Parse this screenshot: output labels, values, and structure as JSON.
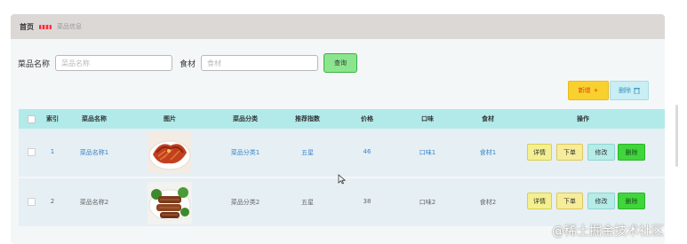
{
  "breadcrumb": {
    "home": "首页",
    "current": "菜品信息"
  },
  "search": {
    "name_label": "菜品名称",
    "name_placeholder": "菜品名称",
    "ingredient_label": "食材",
    "ingredient_placeholder": "食材",
    "query_label": "查询"
  },
  "actions": {
    "add_label": "新增",
    "delete_label": "删除"
  },
  "table": {
    "headers": [
      "索引",
      "菜品名称",
      "图片",
      "菜品分类",
      "推荐指数",
      "价格",
      "口味",
      "食材",
      "操作"
    ],
    "rows": [
      {
        "index": "1",
        "name": "菜品名称1",
        "category": "菜品分类1",
        "rating": "五星",
        "price": "46",
        "taste": "口味1",
        "ingredient": "食材1"
      },
      {
        "index": "2",
        "name": "菜品名称2",
        "category": "菜品分类2",
        "rating": "五星",
        "price": "38",
        "taste": "口味2",
        "ingredient": "食材2"
      }
    ],
    "row_actions": {
      "detail": "详情",
      "order": "下单",
      "edit": "修改",
      "remove": "删除"
    }
  },
  "watermark": "@稀土掘金技术社区",
  "colors": {
    "header_bg": "#b2eaea",
    "add_bg": "#f9d12f",
    "query_bg": "#8be58f",
    "remove_bg": "#3fd63c"
  }
}
